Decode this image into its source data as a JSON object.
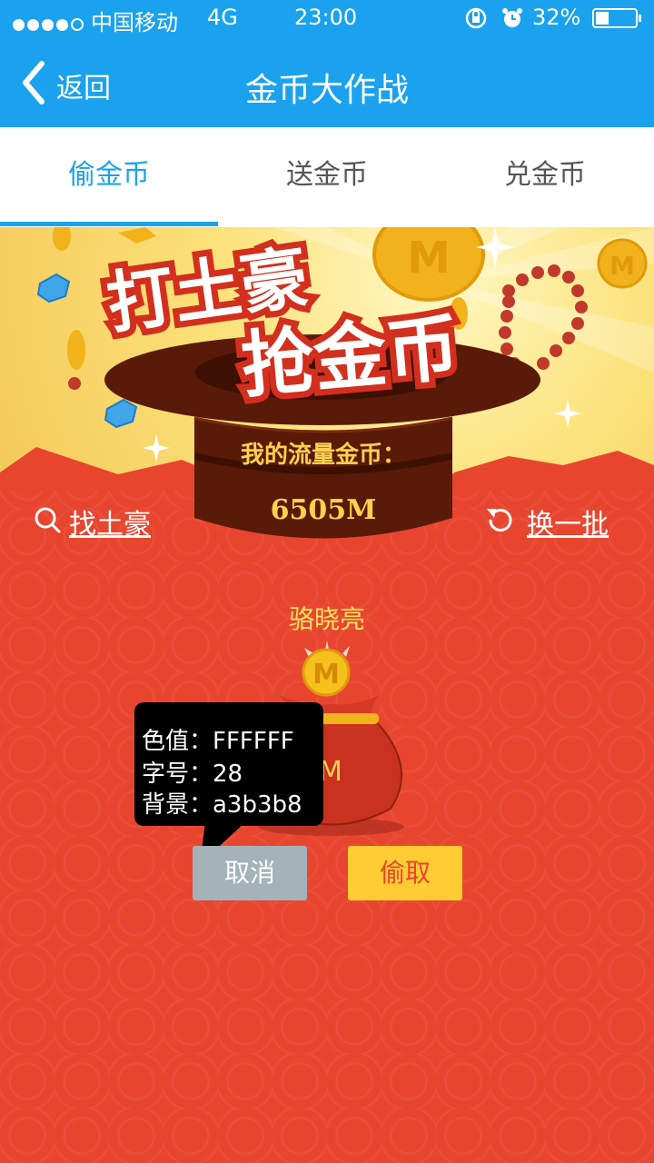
{
  "status_bar": {
    "carrier": "中国移动",
    "network": "4G",
    "time": "23:00",
    "battery": "32%",
    "signal_icon": "signal-dots-icon",
    "lock_icon": "rotation-lock-icon",
    "alarm_icon": "alarm-icon",
    "battery_icon": "battery-icon"
  },
  "nav": {
    "back_label": "返回",
    "title": "金币大作战"
  },
  "tabs": [
    {
      "label": "偷金币",
      "active": true
    },
    {
      "label": "送金币",
      "active": false
    },
    {
      "label": "兑金币",
      "active": false
    }
  ],
  "banner": {
    "headline_line1": "打土豪",
    "headline_line2": "抢金币",
    "coin_symbol": "M"
  },
  "hat": {
    "label": "我的流量金币：",
    "value": "6505M"
  },
  "actions": {
    "find_label": "找土豪",
    "refresh_label": "换一批"
  },
  "target": {
    "name": "骆晓亮",
    "bag_value_suffix": "M"
  },
  "tooltip": {
    "line1": "色值：FFFFFF",
    "line2": "字号：28",
    "line3": "背景：a3b3b8"
  },
  "buttons": {
    "cancel_label": "取消",
    "steal_label": "偷取"
  },
  "colors": {
    "primary_blue": "#1aa2ee",
    "background_red": "#e8452f",
    "gold": "#ffcc33",
    "cancel_gray": "#a3b3b8",
    "title_yellow": "#ffe35c"
  }
}
